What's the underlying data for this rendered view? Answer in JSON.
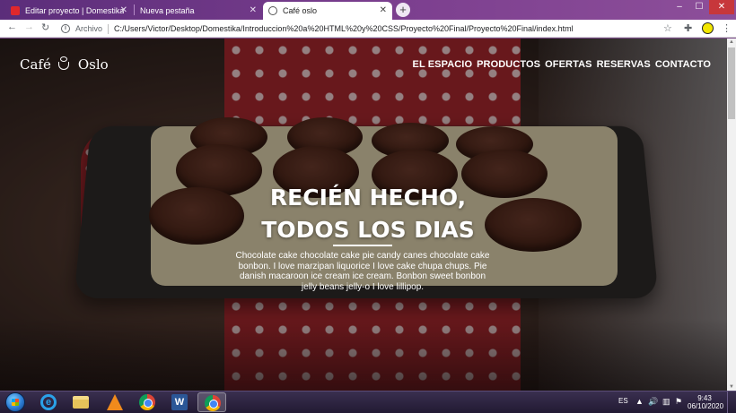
{
  "browser": {
    "tabs": [
      {
        "title": "Editar proyecto | Domestika",
        "active": false
      },
      {
        "title": "Nueva pestaña",
        "active": false
      },
      {
        "title": "Café oslo",
        "active": true
      }
    ],
    "new_tab_glyph": "+",
    "window_controls": {
      "minimize": "–",
      "maximize": "☐",
      "close": "✕"
    },
    "nav": {
      "back": "←",
      "forward": "→",
      "reload": "↻"
    },
    "address": {
      "scheme_label": "Archivo",
      "url": "C:/Users/Victor/Desktop/Domestika/Introduccion%20a%20HTML%20y%20CSS/Proyecto%20Final/Proyecto%20Final/index.html"
    },
    "toolbar_icons": [
      "star-icon",
      "extensions-icon",
      "profile-icon",
      "menu-icon"
    ]
  },
  "site": {
    "logo_left": "Café",
    "logo_right": "Oslo",
    "nav": [
      "EL ESPACIO",
      "PRODUCTOS",
      "OFERTAS",
      "RESERVAS",
      "CONTACTO"
    ],
    "hero": {
      "title_line1": "RECIÉN HECHO,",
      "title_line2": "TODOS LOS DIAS",
      "body": "Chocolate cake chocolate cake pie candy canes chocolate cake bonbon. I love marzipan liquorice I love cake chupa chups. Pie danish macaroon ice cream ice cream. Bonbon sweet bonbon jelly beans jelly-o I love lillipop."
    }
  },
  "taskbar": {
    "apps": [
      "internet-explorer",
      "file-explorer",
      "vlc",
      "chrome",
      "word",
      "chrome-active"
    ],
    "language": "ES",
    "time": "9:43",
    "date": "06/10/2020"
  }
}
